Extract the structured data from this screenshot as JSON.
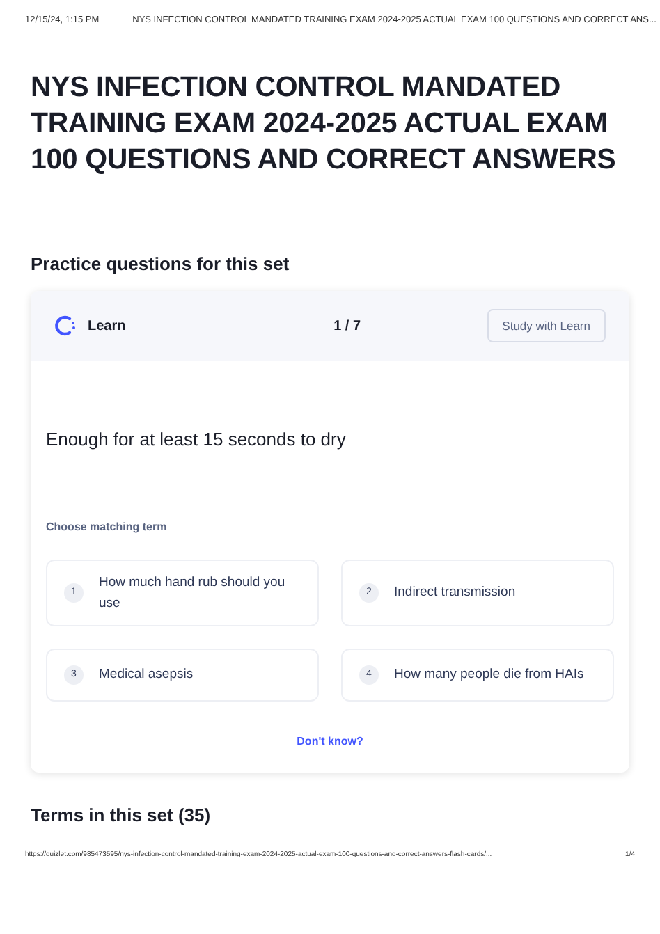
{
  "print_header": {
    "date": "12/15/24, 1:15 PM",
    "title": "NYS INFECTION CONTROL MANDATED TRAINING EXAM 2024-2025 ACTUAL EXAM 100 QUESTIONS AND CORRECT ANS..."
  },
  "title": "NYS INFECTION CONTROL MANDATED TRAINING EXAM 2024-2025 ACTUAL EXAM 100 QUESTIONS AND CORRECT ANSWERS",
  "practice_heading": "Practice questions for this set",
  "card": {
    "mode": "Learn",
    "progress": "1 / 7",
    "study_button": "Study with Learn",
    "question": "Enough for at least 15 seconds to dry",
    "prompt": "Choose matching term",
    "options": [
      {
        "number": "1",
        "text": "How much hand rub should you use"
      },
      {
        "number": "2",
        "text": "Indirect transmission"
      },
      {
        "number": "3",
        "text": "Medical asepsis"
      },
      {
        "number": "4",
        "text": "How many people die from HAIs"
      }
    ],
    "dont_know": "Don't know?"
  },
  "terms_heading": "Terms in this set (35)",
  "print_footer": {
    "url": "https://quizlet.com/985473595/nys-infection-control-mandated-training-exam-2024-2025-actual-exam-100-questions-and-correct-answers-flash-cards/...",
    "page": "1/4"
  }
}
